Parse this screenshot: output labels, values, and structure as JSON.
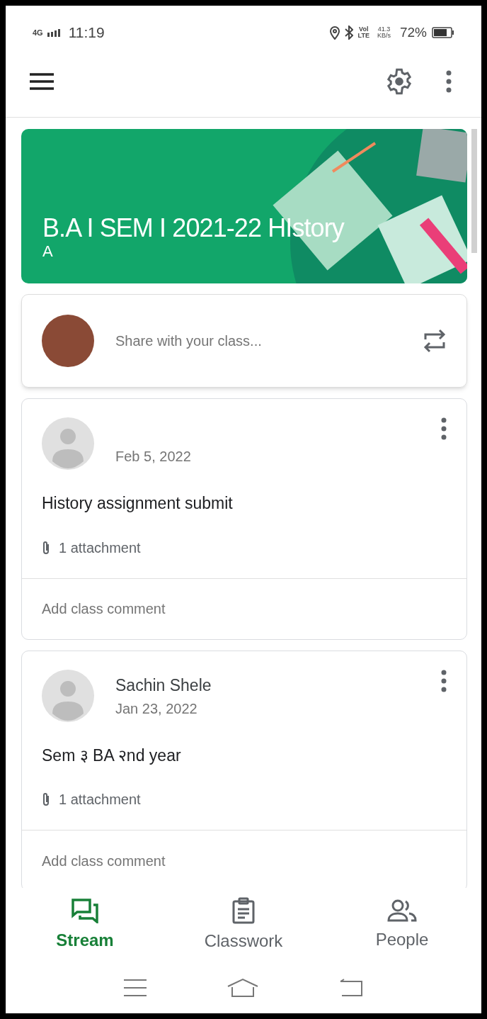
{
  "status_bar": {
    "network": "4G",
    "time": "11:19",
    "volte_top": "Vol",
    "volte_bottom": "LTE",
    "speed_value": "41.3",
    "speed_unit": "KB/s",
    "battery": "72%"
  },
  "banner": {
    "title": "B.A I SEM I 2021-22 HIstory",
    "section": "A"
  },
  "share": {
    "placeholder": "Share with your class..."
  },
  "posts": [
    {
      "date": "Feb 5, 2022",
      "text": "History assignment submit",
      "attachments": "1 attachment",
      "comment_placeholder": "Add class comment"
    },
    {
      "author": "Sachin Shele",
      "date": "Jan 23, 2022",
      "text": "Sem ३ BA २nd year",
      "attachments": "1 attachment",
      "comment_placeholder": "Add class comment"
    }
  ],
  "bottom_nav": [
    {
      "label": "Stream",
      "kind": "stream",
      "selected": true
    },
    {
      "label": "Classwork",
      "kind": "classwork",
      "selected": false
    },
    {
      "label": "People",
      "kind": "people",
      "selected": false
    }
  ]
}
